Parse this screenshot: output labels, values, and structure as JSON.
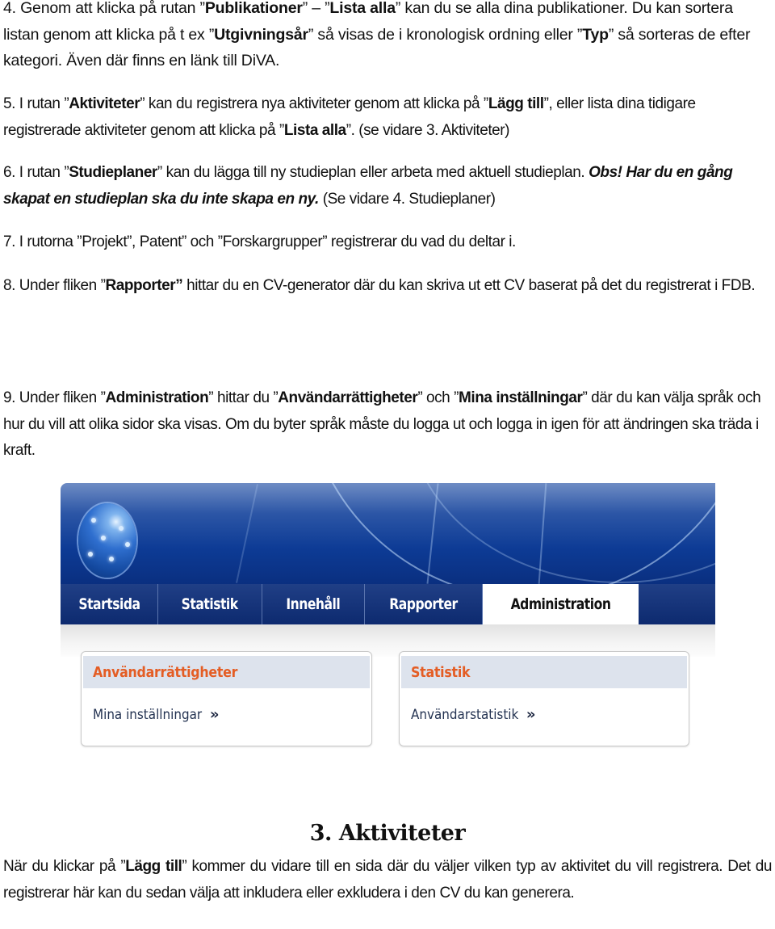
{
  "paragraphs": {
    "p4": {
      "number": "4.",
      "t1": " Genom att klicka på rutan ”",
      "b1": "Publikationer",
      "t2": "” – ”",
      "b2": "Lista alla",
      "t3": "” kan du se alla dina publikationer. Du kan sortera listan genom att klicka på t ex ”",
      "b3": "Utgivningsår",
      "t4": "” så visas de i kronologisk ordning eller ”",
      "b4": "Typ",
      "t5": "” så sorteras de efter kategori.  Även där finns en länk till DiVA."
    },
    "p5": {
      "number": "5.",
      "t1": " I rutan ”",
      "b1": "Aktiviteter",
      "t2": "” kan du registrera nya aktiviteter genom att klicka på ”",
      "b2": "Lägg till",
      "t3": "”, eller lista dina tidigare registrerade aktiviteter genom att klicka på ”",
      "b3": "Lista alla",
      "t4": "”. (se vidare 3. Aktiviteter)"
    },
    "p6": {
      "number": "6.",
      "t1": " I rutan ”",
      "b1": "Studieplaner",
      "t2": "” kan du lägga till ny studieplan eller arbeta med aktuell studieplan.  ",
      "bi1": "Obs! Har du en gång skapat en studieplan ska du inte skapa en ny.",
      "t3": " (Se vidare 4. Studieplaner)"
    },
    "p7": {
      "text": "7. I rutorna ”Projekt”, Patent” och ”Forskargrupper” registrerar du vad du deltar i."
    },
    "p8": {
      "number": "8.",
      "t1": " Under fliken ”",
      "b1": "Rapporter”",
      "t2": " hittar du en CV-generator där du kan skriva ut ett CV baserat på det du registrerat i FDB."
    },
    "p9": {
      "number": "9.",
      "t1": " Under fliken ”",
      "b1": "Administration",
      "t2": "” hittar du ”",
      "b2": "Användarrättigheter",
      "t3": "” och ”",
      "b3": "Mina inställningar",
      "t4": "” där du kan välja språk och hur du vill att olika sidor ska visas.  Om du byter språk måste du logga ut och logga in igen för att ändringen ska träda i kraft."
    }
  },
  "screenshot": {
    "logo": "globe-logo",
    "nav_tabs": [
      {
        "label": "Startsida",
        "active": false
      },
      {
        "label": "Statistik",
        "active": false
      },
      {
        "label": "Innehåll",
        "active": false
      },
      {
        "label": "Rapporter",
        "active": false
      },
      {
        "label": "Administration",
        "active": true
      }
    ],
    "cards": [
      {
        "title": "Användarrättigheter",
        "link": "Mina inställningar",
        "link_icon": "»"
      },
      {
        "title": "Statistik",
        "link": "Användarstatistik",
        "link_icon": "»"
      }
    ],
    "colors": {
      "banner_blue": "#0d3b95",
      "card_title_orange": "#e45d24",
      "card_header_bg": "#dde3ed",
      "link_text": "#243352"
    }
  },
  "section3": {
    "heading": "3. Aktiviteter",
    "t1": "När du klickar på ”",
    "b1": "Lägg till",
    "t2": "” kommer du vidare till en sida där du väljer vilken typ av aktivitet du vill registrera.  Det du registrerar här kan du sedan välja att inkludera eller exkludera i den CV du kan generera."
  }
}
